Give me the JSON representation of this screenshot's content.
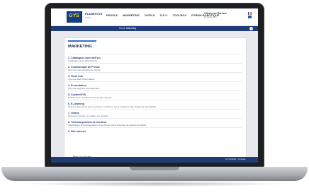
{
  "app": {
    "brand_name": "PLANETGYS",
    "brand_sub": "GYS.fr",
    "logo_text": "GYS"
  },
  "nav": {
    "items": [
      "PEOPLE",
      "MARKETING",
      "OUTILS",
      "S.A.V.",
      "TOOLBOX",
      "FORUM ROBOTIQUE"
    ]
  },
  "account": {
    "name": "Clémence Bizeret",
    "sub": "Déconnexion"
  },
  "breadcrumb": {
    "home": "Home",
    "current": "Marketing"
  },
  "page": {
    "title": "MARKETING",
    "items": [
      {
        "title": "1. Catalogues avec tarif (s)",
        "sub": "Catalogues avec tarifs France"
      },
      {
        "title": "2. Communiqué de Presse",
        "sub": "Tous les communiqués de presse"
      },
      {
        "title": "3. Flash Info",
        "sub": "Tous les flash d'information"
      },
      {
        "title": "4. Presentation",
        "sub": "Tous les supports promotionnels"
      },
      {
        "title": "5. ContentGYS",
        "sub": "Retrouvez les contenus GYS à votre marque"
      },
      {
        "title": "6. E-Learning",
        "sub": "Tous les documents pour se former et informer sur la soudure et les chargeurs de batteries"
      },
      {
        "title": "7. Vidéos",
        "sub": "Découvrez toutes nos vidéos sur Youtube"
      },
      {
        "title": "8. Téléchargements de Contenu",
        "sub": "Téléchargez la documentation et les photos d'une sélection de gammes produits"
      },
      {
        "title": "9. Site Internet",
        "sub": ""
      }
    ],
    "sub_links": [
      "Mise à jour Fiches",
      "Mise à jour Manuels"
    ]
  },
  "footer": {
    "text": "GYS©2020 - Contact"
  },
  "colors": {
    "primary": "#1f3c78",
    "accent": "#3c6dd1"
  }
}
